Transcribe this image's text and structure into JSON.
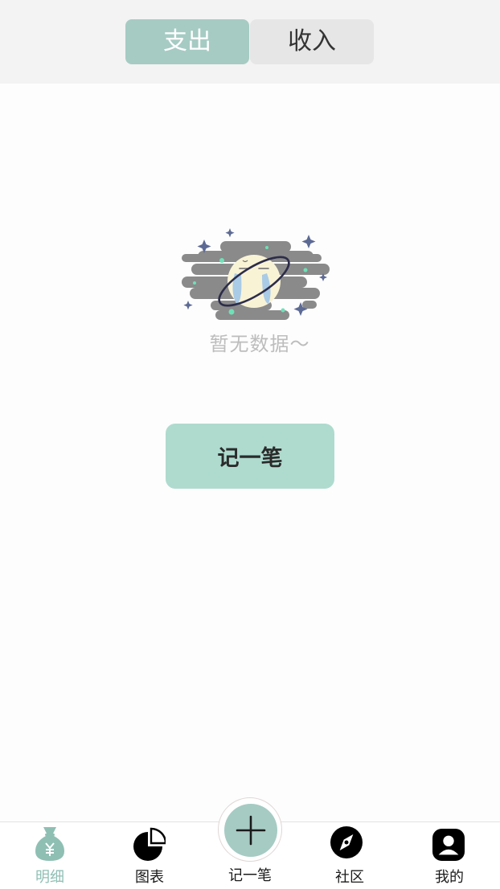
{
  "header": {
    "tabs": [
      {
        "label": "支出",
        "active": true
      },
      {
        "label": "收入",
        "active": false
      }
    ]
  },
  "empty_state": {
    "illustration": "crying-planet-icon",
    "message": "暂无数据～"
  },
  "primary_action": {
    "label": "记一笔"
  },
  "tabbar": {
    "items": [
      {
        "label": "明细",
        "icon": "money-bag-icon",
        "active": true
      },
      {
        "label": "图表",
        "icon": "pie-chart-icon",
        "active": false
      },
      {
        "label": "记一笔",
        "icon": "plus-icon",
        "active": false
      },
      {
        "label": "社区",
        "icon": "compass-icon",
        "active": false
      },
      {
        "label": "我的",
        "icon": "user-icon",
        "active": false
      }
    ]
  },
  "colors": {
    "accent": "#a6cbc3",
    "button": "#afdbcf",
    "active_label": "#8fbfb3",
    "header_bg": "#f3f3f3"
  }
}
